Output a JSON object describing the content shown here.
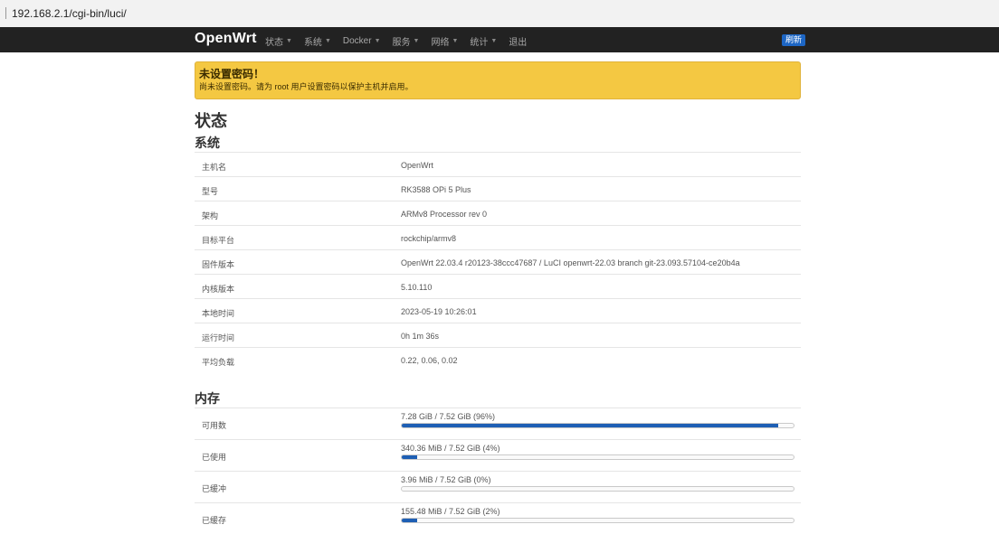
{
  "browser": {
    "url": "192.168.2.1/cgi-bin/luci/"
  },
  "navbar": {
    "brand": "OpenWrt",
    "menu": [
      {
        "label": "状态",
        "dropdown": true
      },
      {
        "label": "系统",
        "dropdown": true
      },
      {
        "label": "Docker",
        "dropdown": true
      },
      {
        "label": "服务",
        "dropdown": true
      },
      {
        "label": "网络",
        "dropdown": true
      },
      {
        "label": "统计",
        "dropdown": true
      },
      {
        "label": "退出",
        "dropdown": false
      }
    ],
    "refresh_label": "刷新"
  },
  "alert": {
    "title": "未设置密码！",
    "message": "尚未设置密码。请为 root 用户设置密码以保护主机并启用。"
  },
  "page_title": "状态",
  "system": {
    "heading": "系统",
    "rows": [
      {
        "key": "主机名",
        "value": "OpenWrt"
      },
      {
        "key": "型号",
        "value": "RK3588 OPi 5 Plus"
      },
      {
        "key": "架构",
        "value": "ARMv8 Processor rev 0"
      },
      {
        "key": "目标平台",
        "value": "rockchip/armv8"
      },
      {
        "key": "固件版本",
        "value": "OpenWrt 22.03.4 r20123-38ccc47687 / LuCI openwrt-22.03 branch git-23.093.57104-ce20b4a"
      },
      {
        "key": "内核版本",
        "value": "5.10.110"
      },
      {
        "key": "本地时间",
        "value": "2023-05-19 10:26:01"
      },
      {
        "key": "运行时间",
        "value": "0h 1m 36s"
      },
      {
        "key": "平均负载",
        "value": "0.22, 0.06, 0.02"
      }
    ]
  },
  "memory": {
    "heading": "内存",
    "rows": [
      {
        "key": "可用数",
        "text": "7.28 GiB / 7.52 GiB (96%)",
        "percent": 96
      },
      {
        "key": "已使用",
        "text": "340.36 MiB / 7.52 GiB (4%)",
        "percent": 4
      },
      {
        "key": "已缓冲",
        "text": "3.96 MiB / 7.52 GiB (0%)",
        "percent": 0
      },
      {
        "key": "已缓存",
        "text": "155.48 MiB / 7.52 GiB (2%)",
        "percent": 2
      }
    ]
  },
  "colors": {
    "navbar": "#222222",
    "alert": "#f4c842",
    "progress": "#1e5fb4",
    "refresh": "#1d66c4"
  }
}
